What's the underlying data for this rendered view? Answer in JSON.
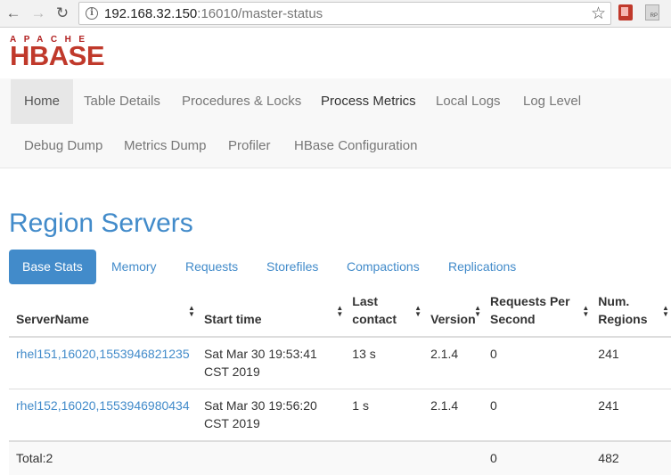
{
  "browser": {
    "back_icon": "arrow-left-icon",
    "forward_icon": "arrow-right-icon",
    "reload_icon": "reload-icon",
    "url_host": "192.168.32.150",
    "url_rest": ":16010/master-status",
    "star_icon": "bookmark-star-icon"
  },
  "logo": {
    "top": "APACHE",
    "main": "HBASE"
  },
  "nav": {
    "items": [
      "Home",
      "Table Details",
      "Procedures & Locks",
      "Process Metrics",
      "Local Logs",
      "Log Level",
      "Debug Dump",
      "Metrics Dump",
      "Profiler",
      "HBase Configuration"
    ]
  },
  "section": {
    "title": "Region Servers"
  },
  "tabs": [
    "Base Stats",
    "Memory",
    "Requests",
    "Storefiles",
    "Compactions",
    "Replications"
  ],
  "table": {
    "headers": [
      "ServerName",
      "Start time",
      "Last contact",
      "Version",
      "Requests Per Second",
      "Num. Regions"
    ],
    "rows": [
      [
        "rhel151,16020,1553946821235",
        "Sat Mar 30 19:53:41 CST 2019",
        "13 s",
        "2.1.4",
        "0",
        "241"
      ],
      [
        "rhel152,16020,1553946980434",
        "Sat Mar 30 19:56:20 CST 2019",
        "1 s",
        "2.1.4",
        "0",
        "241"
      ]
    ],
    "total": [
      "Total:2",
      "",
      "",
      "",
      "0",
      "482"
    ]
  },
  "colors": {
    "accent": "#428bca",
    "logo": "#c0392b"
  }
}
